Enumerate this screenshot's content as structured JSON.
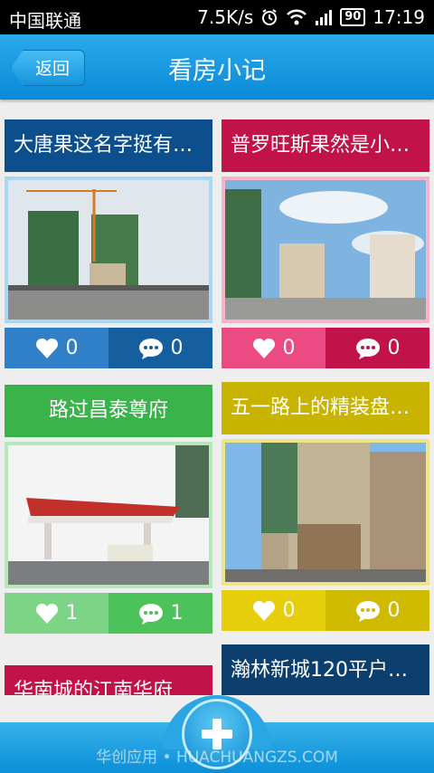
{
  "status_bar": {
    "carrier": "中国联通",
    "speed": "7.5K/s",
    "battery": "90",
    "time": "17:19"
  },
  "header": {
    "back_label": "返回",
    "title": "看房小记"
  },
  "cards": [
    {
      "title": "大唐果这名字挺有…",
      "likes": "0",
      "comments": "0",
      "colors": {
        "title": "#0c4f8c",
        "like_bg": "#2f80c8",
        "comment_bg": "#155f9e",
        "frame": "#a9d7f2"
      }
    },
    {
      "title": "普罗旺斯果然是小…",
      "likes": "0",
      "comments": "0",
      "colors": {
        "title": "#c2124a",
        "like_bg": "#ec4a83",
        "comment_bg": "#c2124a",
        "frame": "#f6b3ca"
      }
    },
    {
      "title": "路过昌泰尊府",
      "likes": "1",
      "comments": "1",
      "colors": {
        "title": "#39b34a",
        "like_bg": "#7ed486",
        "comment_bg": "#4cc25b",
        "frame": "#b7e8bc"
      }
    },
    {
      "title": "五一路上的精装盘…",
      "likes": "0",
      "comments": "0",
      "colors": {
        "title": "#c8b400",
        "like_bg": "#e6ce0a",
        "comment_bg": "#d0ba00",
        "frame": "#f0e48a"
      }
    },
    {
      "title": "华南城的江南华府",
      "colors": {
        "title": "#c2124a"
      }
    },
    {
      "title": "瀚林新城120平户…",
      "colors": {
        "title": "#0c3f6e"
      }
    }
  ],
  "bottom": {
    "add_icon": "plus-icon",
    "watermark": "华创应用 • HUACHUANGZS.COM"
  }
}
